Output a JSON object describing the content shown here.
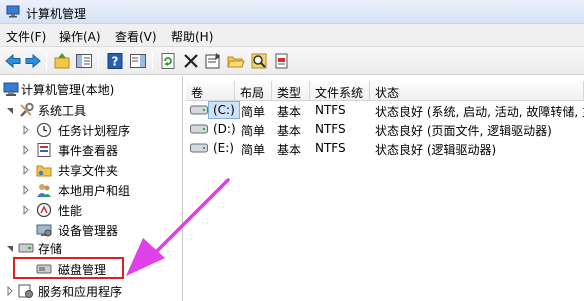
{
  "window": {
    "title": "计算机管理"
  },
  "menu": [
    {
      "label": "文件(F)"
    },
    {
      "label": "操作(A)"
    },
    {
      "label": "查看(V)"
    },
    {
      "label": "帮助(H)"
    }
  ],
  "toolbar": {
    "icons": [
      "back-icon",
      "forward-icon",
      "up-folder-icon",
      "show-hide-tree-icon",
      "help-icon",
      "action-pane-icon",
      "refresh-icon",
      "delete-icon",
      "properties-icon",
      "open-folder-icon",
      "search-icon",
      "disk-settings-icon"
    ]
  },
  "tree": {
    "root": {
      "label": "计算机管理(本地)"
    },
    "system_tools": {
      "label": "系统工具"
    },
    "task_scheduler": {
      "label": "任务计划程序"
    },
    "event_viewer": {
      "label": "事件查看器"
    },
    "shared_folders": {
      "label": "共享文件夹"
    },
    "local_users": {
      "label": "本地用户和组"
    },
    "performance": {
      "label": "性能"
    },
    "device_manager": {
      "label": "设备管理器"
    },
    "storage": {
      "label": "存储"
    },
    "disk_management": {
      "label": "磁盘管理"
    },
    "services_apps": {
      "label": "服务和应用程序"
    }
  },
  "volumes": {
    "columns": [
      "卷",
      "布局",
      "类型",
      "文件系统",
      "状态"
    ],
    "rows": [
      {
        "volume": "(C:)",
        "layout": "简单",
        "type": "基本",
        "fs": "NTFS",
        "status": "状态良好 (系统, 启动, 活动, 故障转储, 主"
      },
      {
        "volume": "(D:)",
        "layout": "简单",
        "type": "基本",
        "fs": "NTFS",
        "status": "状态良好 (页面文件, 逻辑驱动器)"
      },
      {
        "volume": "(E:)",
        "layout": "简单",
        "type": "基本",
        "fs": "NTFS",
        "status": "状态良好 (逻辑驱动器)"
      }
    ]
  },
  "colors": {
    "highlight": "#e02020",
    "annotation_arrow": "#e040e8",
    "selection": "#cfe3fb"
  }
}
